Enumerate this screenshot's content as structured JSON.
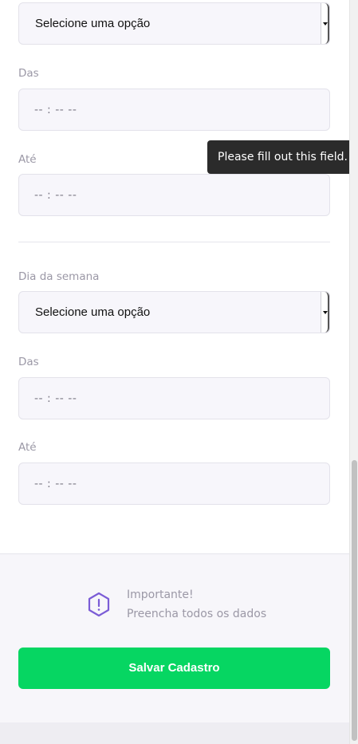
{
  "schedule_block_1": {
    "day_select": {
      "value": "Selecione uma opção"
    },
    "from_label": "Das",
    "from_value": "-- : --   --",
    "to_label": "Até",
    "to_value": "-- : --   --"
  },
  "tooltip": {
    "text": "Please fill out this field."
  },
  "schedule_block_2": {
    "day_label": "Dia da semana",
    "day_select": {
      "value": "Selecione uma opção"
    },
    "from_label": "Das",
    "from_value": "-- : --   --",
    "to_label": "Até",
    "to_value": "-- : --   --"
  },
  "notice": {
    "icon": "alert-hexagon-icon",
    "title": "Importante!",
    "text": "Preencha todos os dados"
  },
  "actions": {
    "save_label": "Salvar Cadastro"
  },
  "colors": {
    "accent_green": "#06d662",
    "notice_icon": "#7b5cd6",
    "field_bg": "#f7f6fb"
  }
}
